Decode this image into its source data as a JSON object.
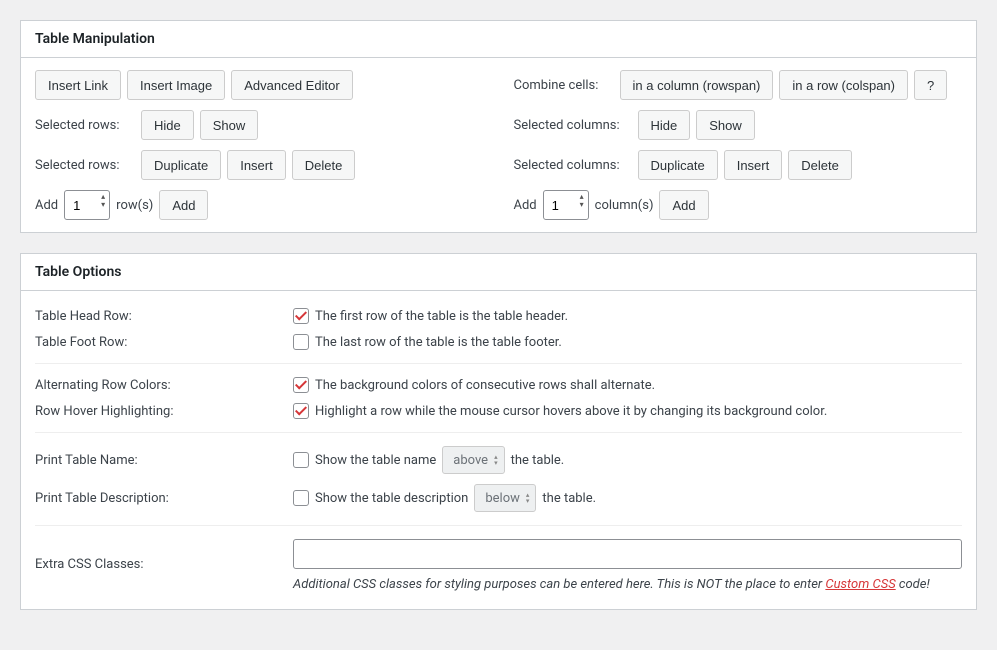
{
  "manip": {
    "title": "Table Manipulation",
    "insert_link": "Insert Link",
    "insert_image": "Insert Image",
    "advanced_editor": "Advanced Editor",
    "combine_cells": "Combine cells:",
    "rowspan": "in a column (rowspan)",
    "colspan": "in a row (colspan)",
    "help": "?",
    "selected_rows": "Selected rows:",
    "selected_columns": "Selected columns:",
    "hide": "Hide",
    "show": "Show",
    "duplicate": "Duplicate",
    "insert": "Insert",
    "delete": "Delete",
    "add": "Add",
    "rows_value": "1",
    "rows_unit": "row(s)",
    "cols_value": "1",
    "cols_unit": "column(s)",
    "add_btn": "Add"
  },
  "opts": {
    "title": "Table Options",
    "head_label": "Table Head Row:",
    "head_desc": "The first row of the table is the table header.",
    "foot_label": "Table Foot Row:",
    "foot_desc": "The last row of the table is the table footer.",
    "alt_label": "Alternating Row Colors:",
    "alt_desc": "The background colors of consecutive rows shall alternate.",
    "hover_label": "Row Hover Highlighting:",
    "hover_desc": "Highlight a row while the mouse cursor hovers above it by changing its background color.",
    "print_name_label": "Print Table Name:",
    "print_name_pre": "Show the table name",
    "print_name_sel": "above",
    "print_name_post": "the table.",
    "print_desc_label": "Print Table Description:",
    "print_desc_pre": "Show the table description",
    "print_desc_sel": "below",
    "print_desc_post": "the table.",
    "css_label": "Extra CSS Classes:",
    "css_hint_pre": "Additional CSS classes for styling purposes can be entered here. This is NOT the place to enter ",
    "css_hint_link": "Custom CSS",
    "css_hint_post": " code!"
  }
}
